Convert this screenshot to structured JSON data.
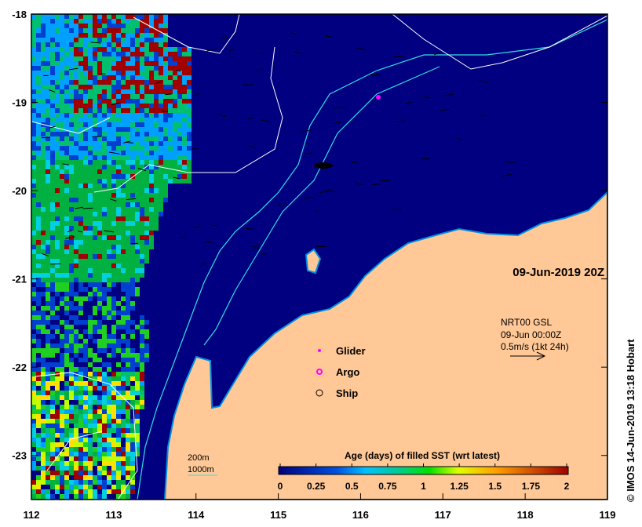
{
  "map": {
    "date_label": "09-Jun-2019 20Z",
    "credit": "© IMOS 14-Jun-2019 13:18 Hobart",
    "lon_ticks": [
      "112",
      "113",
      "114",
      "115",
      "116",
      "117",
      "118",
      "119"
    ],
    "lat_ticks": [
      "-18",
      "-19",
      "-20",
      "-21",
      "-22",
      "-23"
    ],
    "lon_range": [
      112,
      119
    ],
    "lat_range": [
      -23.5,
      -18
    ],
    "colors": {
      "ocean": "#000080",
      "land": "#ffc896",
      "contour_200": "#00d0e0",
      "contour_1000": "#ffffff"
    }
  },
  "legend": {
    "glider": "Glider",
    "argo": "Argo",
    "ship": "Ship",
    "contour_200": "200m",
    "contour_1000": "1000m"
  },
  "current": {
    "line1": "NRT00 GSL",
    "line2": "09-Jun 00:00Z",
    "line3": "0.5m/s (1kt 24h)"
  },
  "colorbar": {
    "title": "Age (days) of filled SST (wrt latest)",
    "ticks": [
      "0",
      "0.25",
      "0.5",
      "0.75",
      "1",
      "1.25",
      "1.5",
      "1.75",
      "2"
    ],
    "range": [
      0,
      2
    ]
  }
}
